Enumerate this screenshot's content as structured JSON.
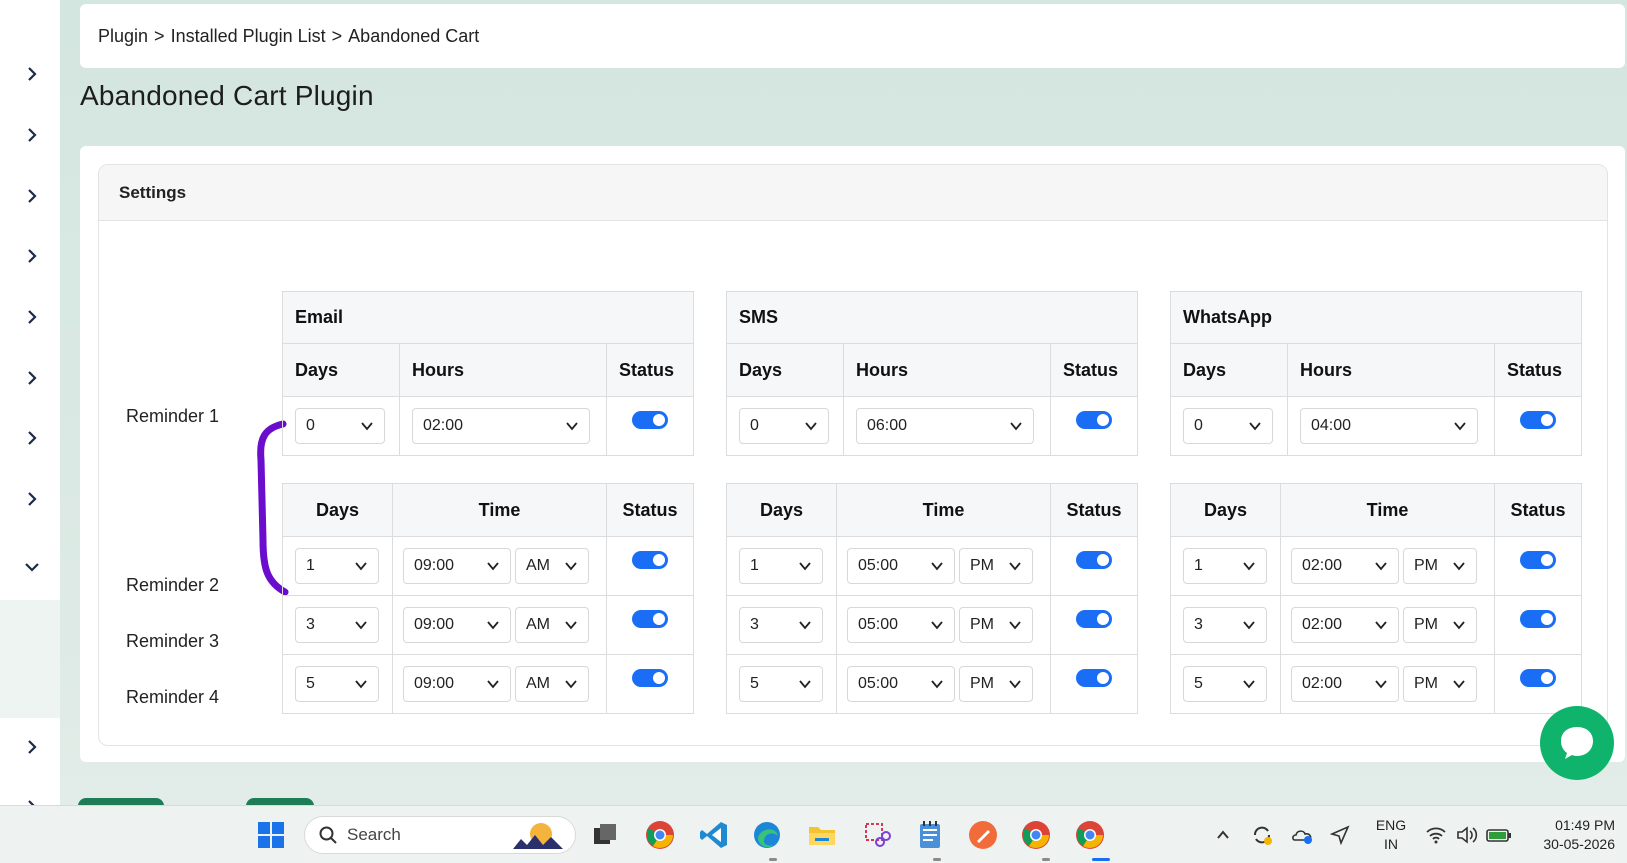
{
  "breadcrumb": {
    "items": [
      "Plugin",
      "Installed Plugin List",
      "Abandoned Cart"
    ],
    "separator": ">"
  },
  "page": {
    "title": "Abandoned Cart Plugin"
  },
  "settings": {
    "title": "Settings",
    "reminder_labels": [
      "Reminder 1",
      "Reminder 2",
      "Reminder 3",
      "Reminder 4"
    ],
    "headers": {
      "days": "Days",
      "hours": "Hours",
      "time": "Time",
      "status": "Status"
    },
    "channels": [
      {
        "name": "Email",
        "r1": {
          "days": "0",
          "hours": "02:00",
          "status": true
        },
        "reminders": [
          {
            "days": "1",
            "time": "09:00",
            "ampm": "AM",
            "status": true
          },
          {
            "days": "3",
            "time": "09:00",
            "ampm": "AM",
            "status": true
          },
          {
            "days": "5",
            "time": "09:00",
            "ampm": "AM",
            "status": true
          }
        ]
      },
      {
        "name": "SMS",
        "r1": {
          "days": "0",
          "hours": "06:00",
          "status": true
        },
        "reminders": [
          {
            "days": "1",
            "time": "05:00",
            "ampm": "PM",
            "status": true
          },
          {
            "days": "3",
            "time": "05:00",
            "ampm": "PM",
            "status": true
          },
          {
            "days": "5",
            "time": "05:00",
            "ampm": "PM",
            "status": true
          }
        ]
      },
      {
        "name": "WhatsApp",
        "r1": {
          "days": "0",
          "hours": "04:00",
          "status": true
        },
        "reminders": [
          {
            "days": "1",
            "time": "02:00",
            "ampm": "PM",
            "status": true
          },
          {
            "days": "3",
            "time": "02:00",
            "ampm": "PM",
            "status": true
          },
          {
            "days": "5",
            "time": "02:00",
            "ampm": "PM",
            "status": true
          }
        ]
      }
    ]
  },
  "taskbar": {
    "search_placeholder": "Search",
    "lang_line1": "ENG",
    "lang_line2": "IN",
    "time": "01:49 PM",
    "date": "30-05-2026"
  },
  "colors": {
    "toggle_on": "#1a6ef5",
    "bracket": "#6a0dcc",
    "chat": "#0fb36b",
    "accent_green": "#1e7d56"
  }
}
